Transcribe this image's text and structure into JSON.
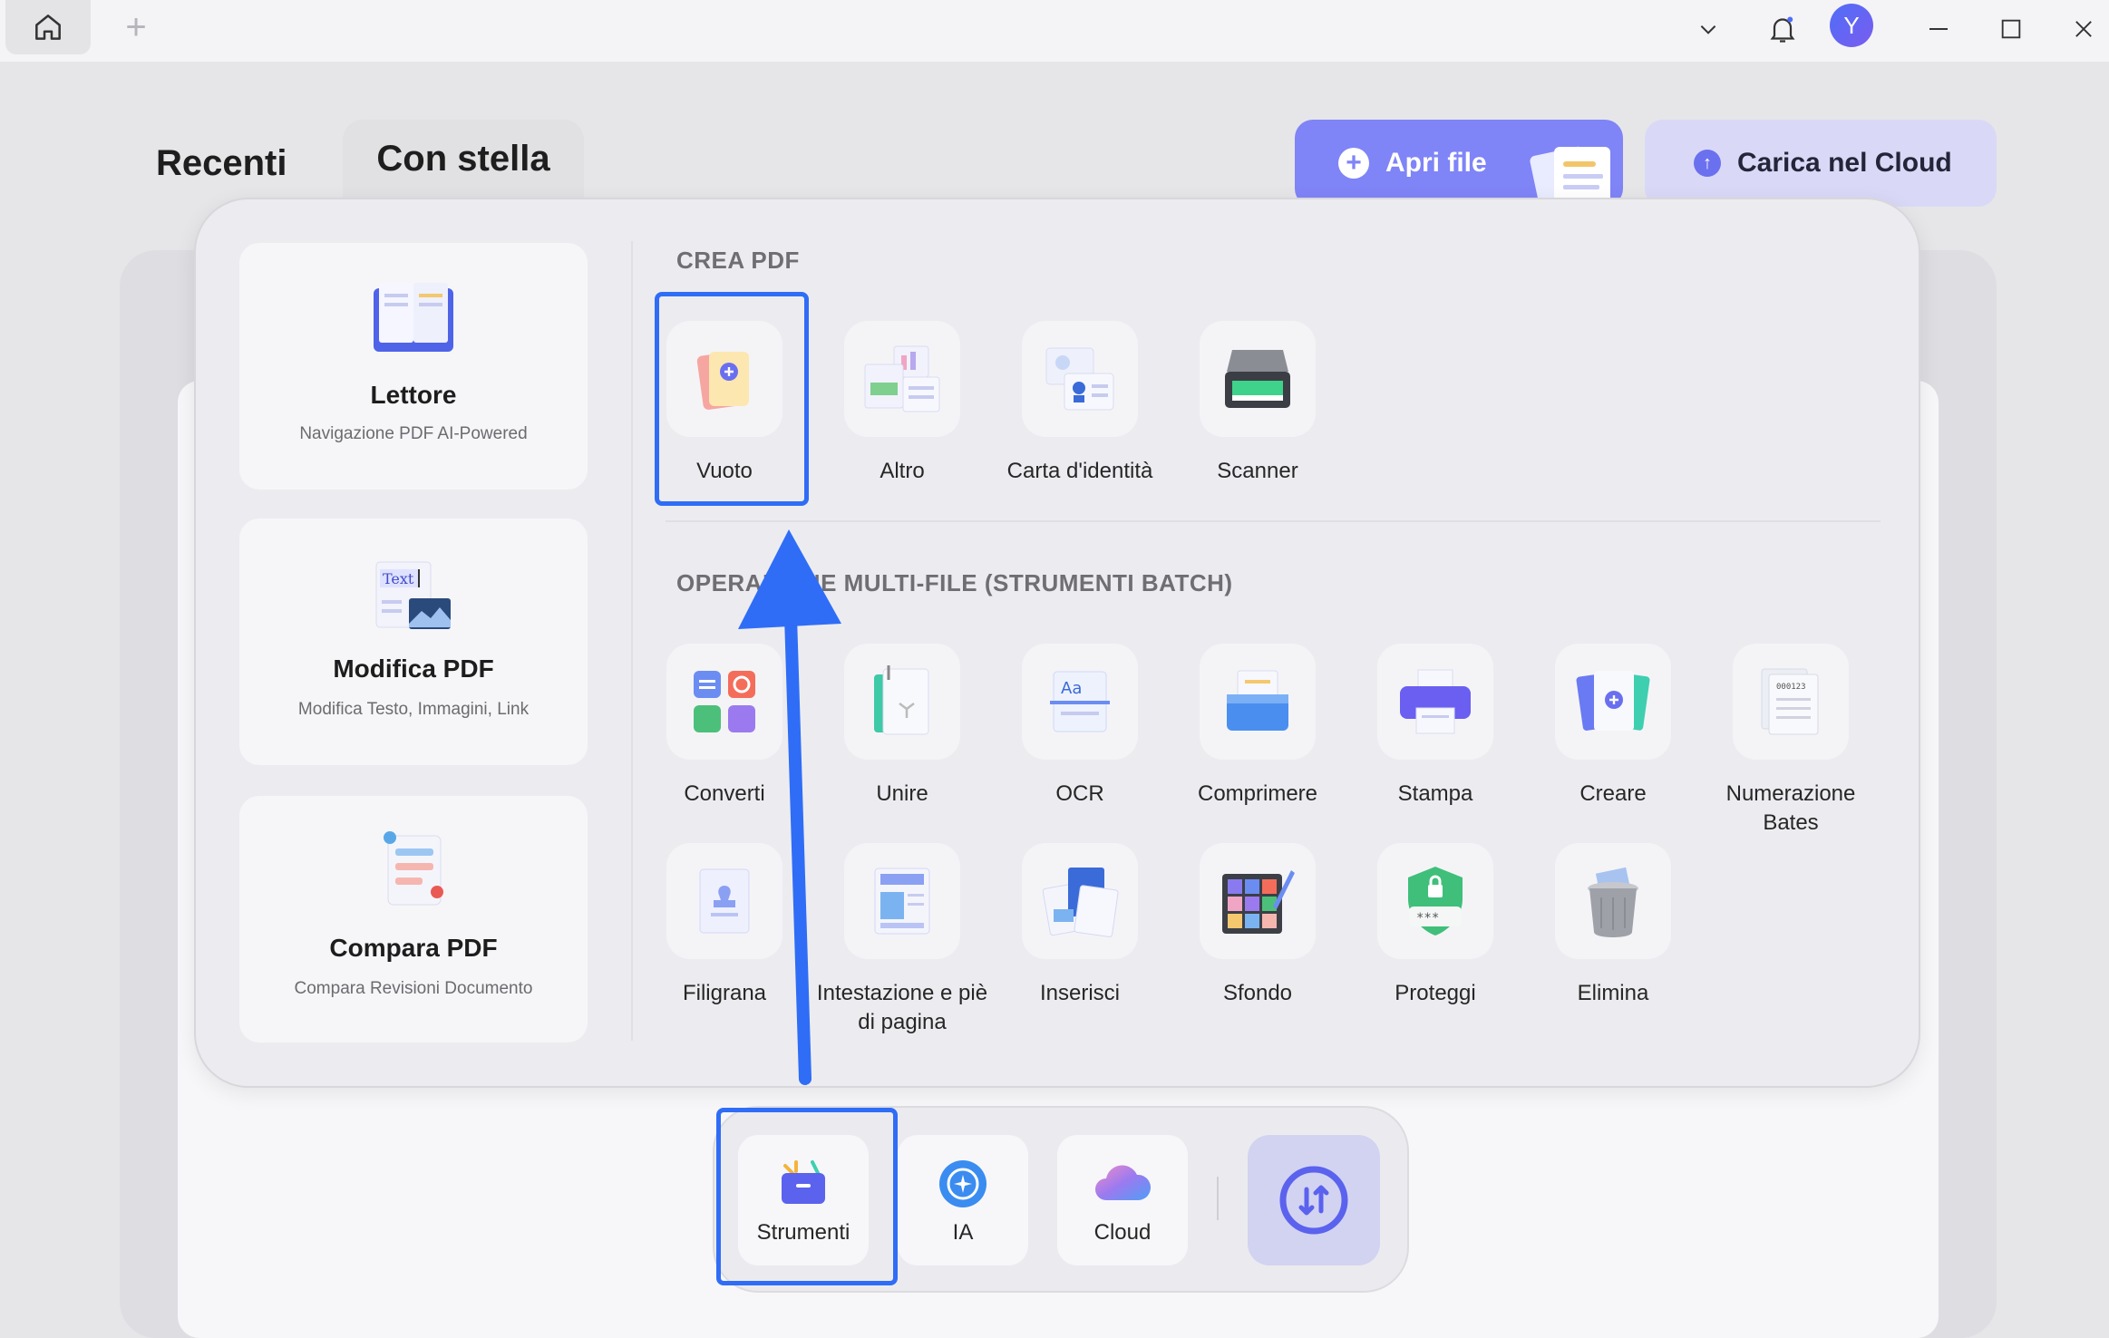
{
  "titlebar": {
    "avatar_initial": "Y"
  },
  "tabs": {
    "recent": "Recenti",
    "starred": "Con stella"
  },
  "actions": {
    "open_file": "Apri file",
    "upload_cloud": "Carica nel Cloud"
  },
  "cards": [
    {
      "title": "Lettore",
      "subtitle": "Navigazione PDF AI-Powered",
      "icon": "book-icon"
    },
    {
      "title": "Modifica PDF",
      "subtitle": "Modifica Testo, Immagini, Link",
      "icon": "edit-text-icon"
    },
    {
      "title": "Compara PDF",
      "subtitle": "Compara Revisioni Documento",
      "icon": "compare-icon"
    }
  ],
  "sections": {
    "create_pdf": "CREA PDF",
    "batch": "OPERAZIONE MULTI-FILE (STRUMENTI BATCH)"
  },
  "create_tools": [
    {
      "label": "Vuoto",
      "icon": "blank-page-icon"
    },
    {
      "label": "Altro",
      "icon": "other-docs-icon"
    },
    {
      "label": "Carta d'identità",
      "icon": "id-card-icon"
    },
    {
      "label": "Scanner",
      "icon": "scanner-icon"
    }
  ],
  "batch_tools": [
    {
      "label": "Converti",
      "icon": "convert-icon"
    },
    {
      "label": "Unire",
      "icon": "merge-icon"
    },
    {
      "label": "OCR",
      "icon": "ocr-icon"
    },
    {
      "label": "Comprimere",
      "icon": "compress-icon"
    },
    {
      "label": "Stampa",
      "icon": "print-icon"
    },
    {
      "label": "Creare",
      "icon": "create-icon"
    },
    {
      "label": "Numerazione Bates",
      "icon": "bates-icon"
    },
    {
      "label": "Filigrana",
      "icon": "watermark-icon"
    },
    {
      "label": "Intestazione e piè di pagina",
      "icon": "header-footer-icon"
    },
    {
      "label": "Inserisci",
      "icon": "insert-icon"
    },
    {
      "label": "Sfondo",
      "icon": "background-icon"
    },
    {
      "label": "Proteggi",
      "icon": "protect-icon"
    },
    {
      "label": "Elimina",
      "icon": "delete-icon"
    }
  ],
  "dock": [
    {
      "label": "Strumenti",
      "icon": "toolbox-icon"
    },
    {
      "label": "IA",
      "icon": "ai-icon"
    },
    {
      "label": "Cloud",
      "icon": "cloud-icon"
    }
  ],
  "colors": {
    "accent": "#7f84f7",
    "highlight": "#2f6df6",
    "panel": "#ececf0"
  }
}
